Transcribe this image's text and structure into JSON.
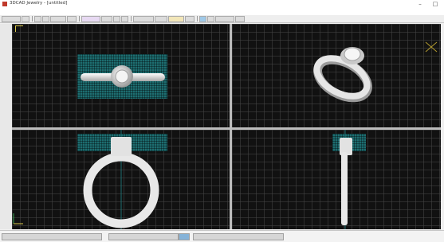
{
  "app": {
    "title": "3DCAD Jewelry - [untitled]",
    "accent_color": "#c0392b"
  },
  "window_controls": {
    "minimize": "–",
    "maximize": "□"
  },
  "menus": [],
  "views": {
    "top": {
      "name": "top-view",
      "guide_color": "#1d6d70"
    },
    "perspective": {
      "name": "perspective-view"
    },
    "front": {
      "name": "front-view"
    },
    "side": {
      "name": "side-view"
    }
  },
  "colors": {
    "viewport_bg": "#111111",
    "grid_line": "#464646",
    "model": "#e6e6e6",
    "guide": "#1d6d70"
  }
}
